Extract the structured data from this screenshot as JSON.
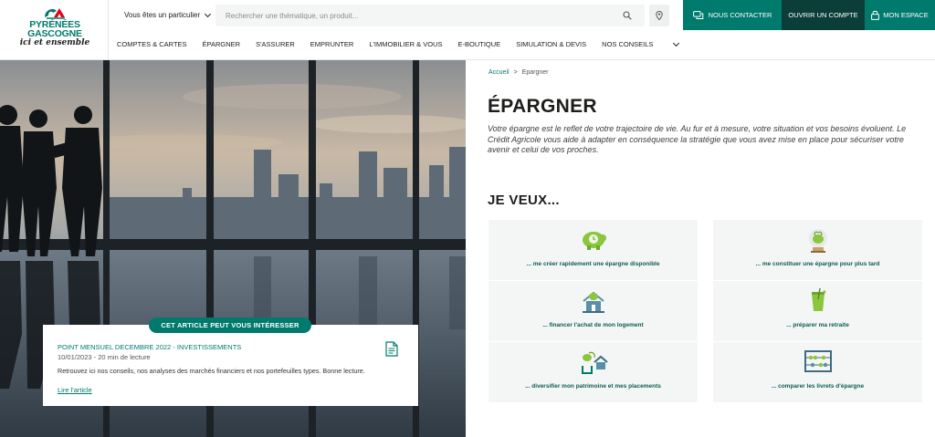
{
  "brand": {
    "name_line1": "PYRÉNÉES",
    "name_line2": "GASCOGNE",
    "tagline": "ici et ensemble",
    "accent_color": "#007a6c",
    "dark_color": "#0b3e39"
  },
  "header": {
    "profile_selector": "Vous êtes un particulier",
    "search_placeholder": "Rechercher une thématique, un produit...",
    "contact_label": "NOUS CONTACTER",
    "open_account_label": "OUVRIR UN COMPTE",
    "my_space_label": "MON ESPACE"
  },
  "nav": {
    "items": [
      "COMPTES & CARTES",
      "ÉPARGNER",
      "S'ASSURER",
      "EMPRUNTER",
      "L'IMMOBILIER & VOUS",
      "E-BOUTIQUE",
      "SIMULATION & DEVIS"
    ],
    "more_label": "NOS CONSEILS"
  },
  "article": {
    "badge": "CET ARTICLE PEUT VOUS INTÉRESSER",
    "title": "POINT MENSUEL DECEMBRE 2022 - INVESTISSEMENTS",
    "meta": "10/01/2023 - 20 min de lecture",
    "description": "Retrouvez ici nos conseils, nos analyses des marchés financiers et nos portefeuilles types. Bonne lecture.",
    "link": "Lire l'article"
  },
  "breadcrumb": {
    "home": "Accueil",
    "separator": ">",
    "current": "Epargner"
  },
  "main": {
    "title": "ÉPARGNER",
    "intro": "Votre épargne est le reflet de votre trajectoire de vie. Au fur et à mesure, votre situation et vos besoins évoluent. Le Crédit Agricole vous aide à adapter en conséquence la stratégie que vous avez mise en place pour sécuriser votre avenir et celui de vos proches.",
    "subtitle": "JE VEUX..."
  },
  "goals": [
    {
      "label": "... me créer rapidement une épargne disponible",
      "icon": "piggy-bank-icon"
    },
    {
      "label": "... me constituer une épargne pour plus tard",
      "icon": "money-plant-icon"
    },
    {
      "label": "... financer l'achat de mon logement",
      "icon": "house-money-icon"
    },
    {
      "label": "... préparer ma retraite",
      "icon": "cocktail-drink-icon"
    },
    {
      "label": "... diversifier mon patrimoine et mes placements",
      "icon": "diversify-icon"
    },
    {
      "label": "... comparer les livrets d'épargne",
      "icon": "abacus-icon"
    }
  ]
}
